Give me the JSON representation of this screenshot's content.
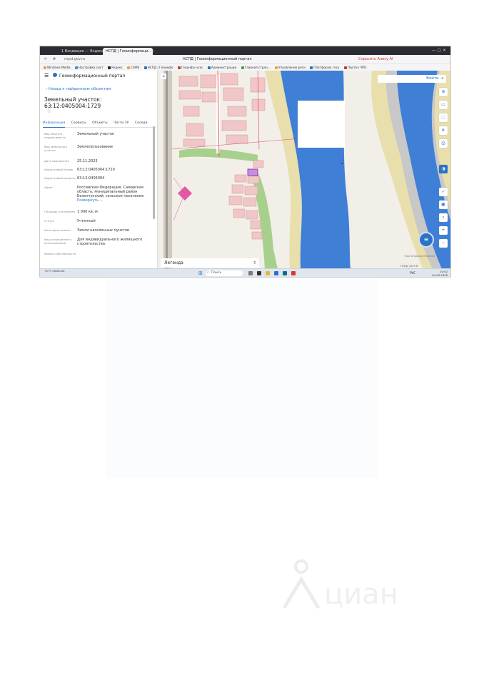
{
  "browser": {
    "tabs": [
      "1 Входящие — Яндекс",
      "НСПД | Геоинформаци..."
    ],
    "url": "nspd.gov.ru",
    "page_title": "НСПД | Геоинформационный портал",
    "alice_label": "Спросить Алису AI",
    "bookmarks": [
      "Windows Media",
      "Настройка сист",
      "Яндекс",
      "CAME",
      "НСПД | Геоинфо",
      "Геоинфо нсис",
      "Администрации",
      "Главная стран...",
      "Управление реги",
      "Платформа госу",
      "Портал ЧПО"
    ]
  },
  "panel": {
    "portal_name": "Геоинформационный портал",
    "back_link": "Назад к найденным объектам",
    "title": "Земельный участок: 63:12:0405004:1729",
    "tabs": [
      "Информация",
      "Сервисы",
      "Объекты",
      "Части ЗУ",
      "Соседи"
    ],
    "active_tab": 0,
    "rows": [
      {
        "label": "Вид объекта недвижимости",
        "value": "Земельный участок"
      },
      {
        "label": "Вид земельного участка",
        "value": "Землепользование"
      },
      {
        "label": "Дата присвоения",
        "value": "25.11.2025"
      },
      {
        "label": "Кадастровый номер",
        "value": "63:12:0405004:1729"
      },
      {
        "label": "Кадастровый квартал",
        "value": "63:12:0405004"
      },
      {
        "label": "Адрес",
        "value": "Российская Федерация, Самарская область, муниципальный район Безенчукский, сельское поселение",
        "more": "Развернуть"
      },
      {
        "label": "Площадь уточненная",
        "value": "1 000 кв. м"
      },
      {
        "label": "Статус",
        "value": "Учтенный"
      },
      {
        "label": "Категория земель",
        "value": "Земли населенных пунктов"
      },
      {
        "label": "Вид разрешенного использования",
        "value": "Для индивидуального жилищного строительства"
      },
      {
        "label": "Форма собственности",
        "value": ""
      }
    ]
  },
  "map": {
    "login_label": "Войти",
    "legend_label": "Легенда",
    "attribution": "Картография Яндекса",
    "scale": "НСПД 1025 В"
  },
  "taskbar": {
    "search_placeholder": "Поиск",
    "time": "10:02",
    "date": "04.03.2026",
    "weather": "+0°C Облачно",
    "lang": "РУС"
  },
  "watermark": {
    "text": "циан"
  },
  "colors": {
    "accent": "#2a73c7",
    "water": "#3f7fd6",
    "sand": "#e9dfad",
    "parcel": "#e0479e",
    "building": "#f0c6c6"
  }
}
